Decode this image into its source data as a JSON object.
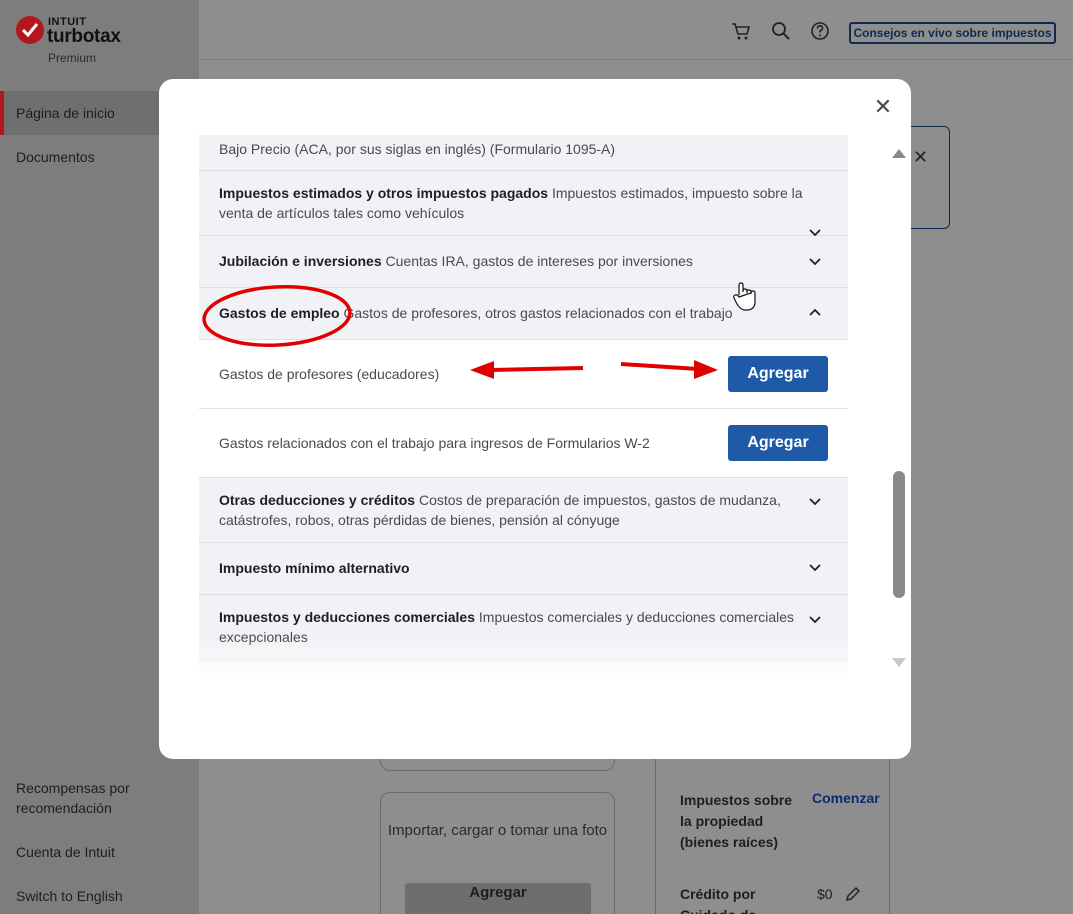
{
  "app": {
    "logo": {
      "brand_top": "INTUIT",
      "brand_main": "turbotax",
      "tier": "Premium"
    },
    "sidebar": {
      "items": [
        {
          "label": "Página de inicio",
          "active": true
        },
        {
          "label": "Documentos",
          "active": false
        }
      ],
      "bottom_links": [
        {
          "label": "Recompensas por recomendación"
        },
        {
          "label": "Cuenta de Intuit"
        },
        {
          "label": "Switch to English"
        }
      ]
    },
    "topbar": {
      "icons": [
        "cart-icon",
        "search-icon",
        "help-icon"
      ],
      "live_button": "Consejos en vivo sobre impuestos"
    },
    "background": {
      "import_text": "Importar, cargar o tomar una foto",
      "import_button": "Agregar",
      "property_label": "Impuestos sobre la propiedad (bienes raíces)",
      "property_action": "Comenzar",
      "credit_label": "Crédito por Cuidado de",
      "credit_value": "$0"
    }
  },
  "modal": {
    "close_icon": "close-icon",
    "rows": [
      {
        "title": "",
        "desc": "Bajo Precio (ACA, por sus siglas en inglés) (Formulario 1095-A)",
        "type": "partial"
      },
      {
        "title": "Impuestos estimados y otros impuestos pagados",
        "desc": "Impuestos estimados, impuesto sobre la venta de artículos tales como vehículos",
        "type": "collapsed"
      },
      {
        "title": "Jubilación e inversiones",
        "desc": "Cuentas IRA, gastos de intereses por inversiones",
        "type": "collapsed"
      },
      {
        "title": "Gastos de empleo",
        "desc": "Gastos de profesores, otros gastos relacionados con el trabajo",
        "type": "expanded"
      },
      {
        "label": "Gastos de profesores (educadores)",
        "button": "Agregar",
        "type": "subitem"
      },
      {
        "label": "Gastos relacionados con el trabajo para ingresos de Formularios W-2",
        "button": "Agregar",
        "type": "subitem"
      },
      {
        "title": "Otras deducciones y créditos",
        "desc": "Costos de preparación de impuestos, gastos de mudanza, catástrofes, robos, otras pérdidas de bienes, pensión al cónyuge",
        "type": "collapsed"
      },
      {
        "title": "Impuesto mínimo alternativo",
        "desc": "",
        "type": "collapsed"
      },
      {
        "title": "Impuestos y deducciones comerciales",
        "desc": "Impuestos comerciales y deducciones comerciales excepcionales",
        "type": "collapsed"
      }
    ]
  },
  "colors": {
    "accent_blue": "#1e5aa8",
    "brand_red": "#b3161d",
    "annotation_red": "#e00000",
    "row_gray": "#f0f2f5"
  }
}
